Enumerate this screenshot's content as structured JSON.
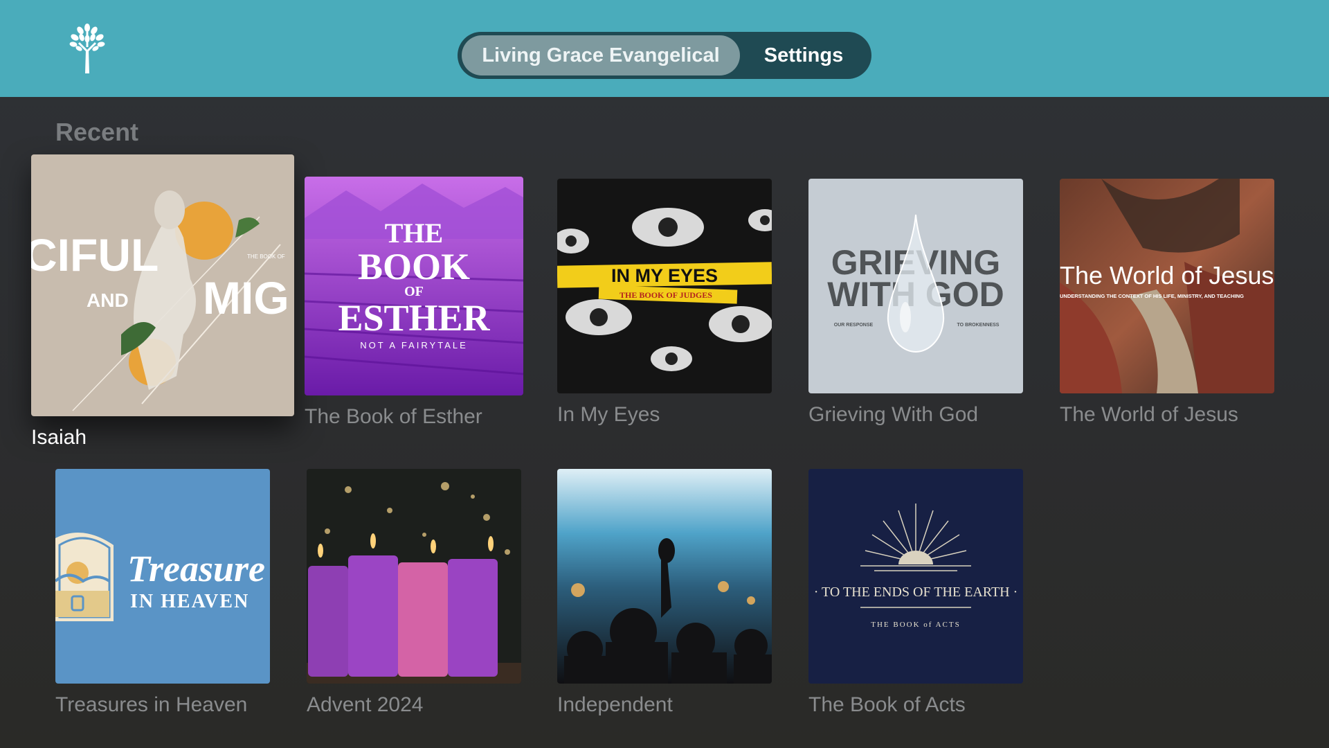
{
  "header": {
    "logo_icon": "tree-icon",
    "tabs": [
      {
        "label": "Living Grace Evangelical",
        "selected": true
      },
      {
        "label": "Settings",
        "selected": false
      }
    ]
  },
  "recent": {
    "heading": "Recent",
    "items": [
      {
        "title": "Isaiah",
        "art_text": [
          "CIFUL",
          "AND",
          "MIG",
          "THE BOOK OF"
        ],
        "focused": true
      },
      {
        "title": "The Book of Esther",
        "art_text": [
          "THE",
          "BOOK",
          "OF",
          "ESTHER",
          "NOT A FAIRYTALE"
        ]
      },
      {
        "title": "In My Eyes",
        "art_text": [
          "IN MY EYES",
          "THE BOOK OF JUDGES"
        ]
      },
      {
        "title": "Grieving With God",
        "art_text": [
          "GRIEVING",
          "WITH GOD",
          "OUR RESPONSE",
          "TO BROKENNESS"
        ]
      },
      {
        "title": "The World of Jesus",
        "art_text": [
          "The World of Jesus",
          "UNDERSTANDING THE CONTEXT OF HIS LIFE, MINISTRY, AND TEACHING"
        ]
      },
      {
        "title": "Treasures in Heaven",
        "art_text": [
          "Treasure",
          "IN HEAVEN"
        ]
      },
      {
        "title": "Advent 2024",
        "art_text": []
      },
      {
        "title": "Independent",
        "art_text": []
      },
      {
        "title": "The Book of Acts",
        "art_text": [
          "· TO THE ENDS OF THE EARTH ·",
          "THE BOOK of ACTS"
        ]
      }
    ]
  },
  "colors": {
    "header_bg": "#4aacbb",
    "segment_bg": "#1f4a53",
    "segment_active": "#7e9a9f",
    "title_dim": "#8a8c8e"
  }
}
